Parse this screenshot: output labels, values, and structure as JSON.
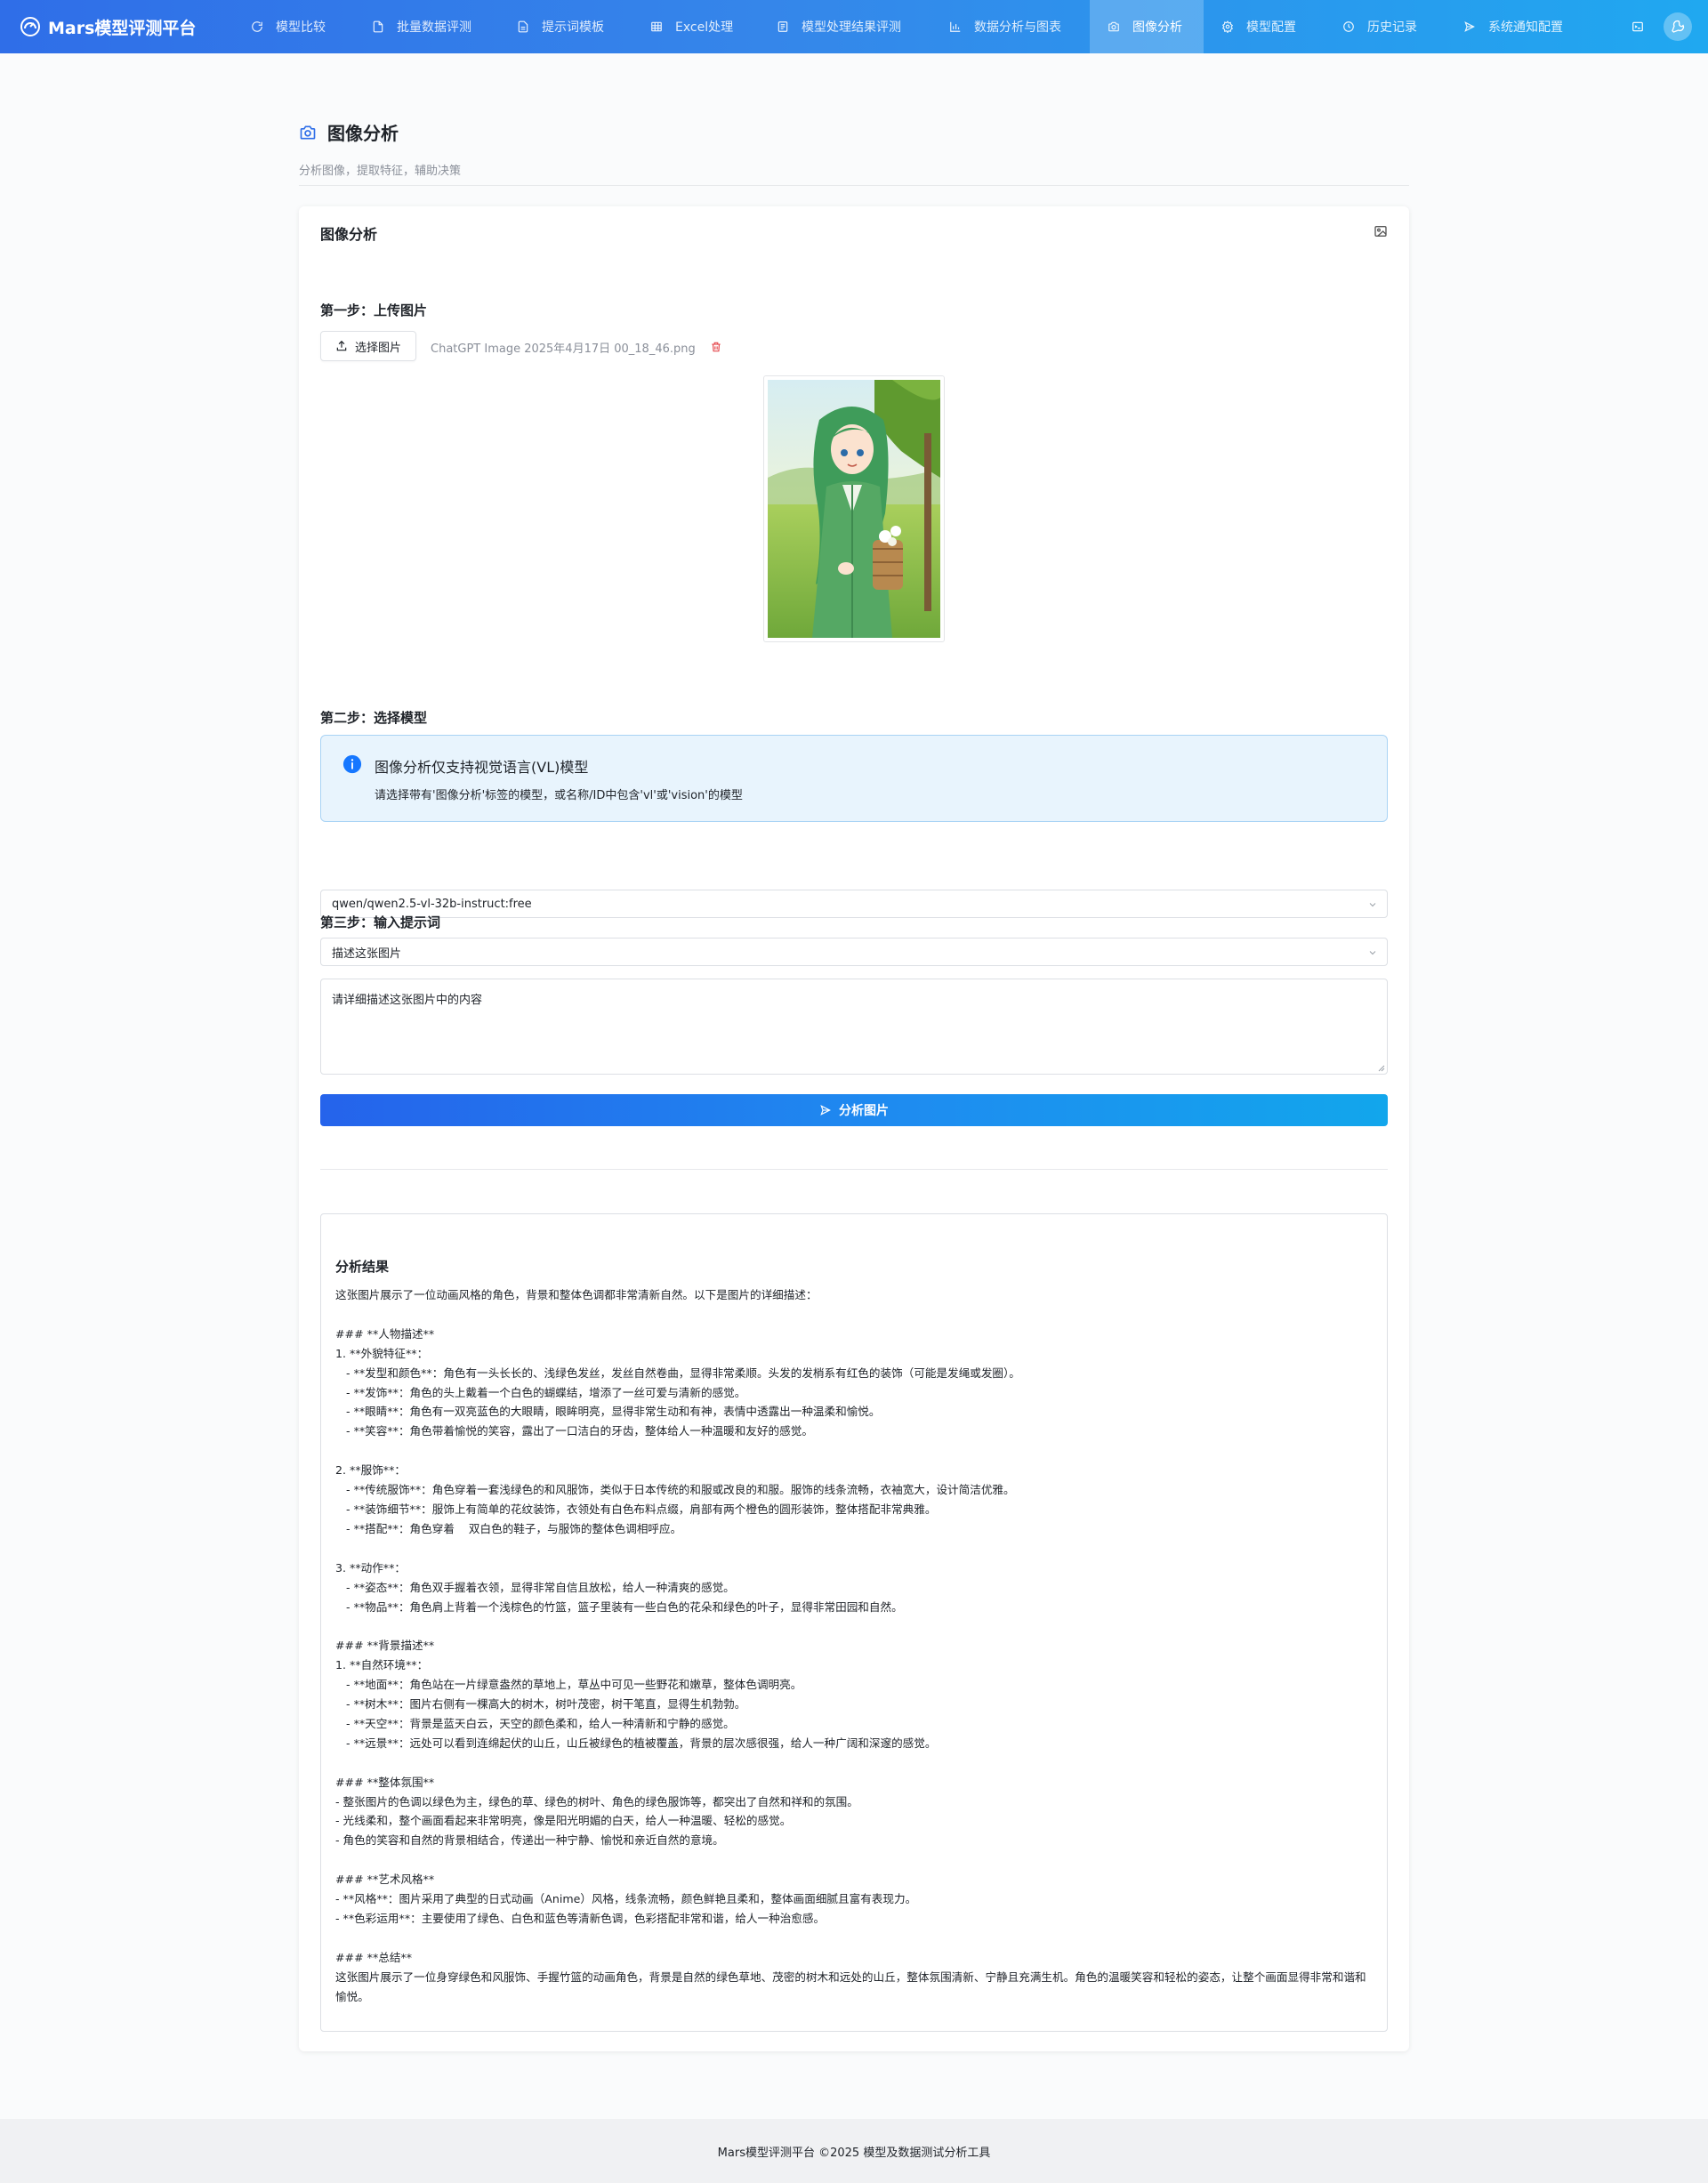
{
  "app": {
    "brand": "Mars模型评测平台"
  },
  "nav": [
    {
      "label": "模型比较",
      "icon": "refresh-icon"
    },
    {
      "label": "批量数据评测",
      "icon": "file-icon"
    },
    {
      "label": "提示词模板",
      "icon": "document-icon"
    },
    {
      "label": "Excel处理",
      "icon": "table-icon"
    },
    {
      "label": "模型处理结果评测",
      "icon": "checklist-icon"
    },
    {
      "label": "数据分析与图表",
      "icon": "bar-chart-icon"
    },
    {
      "label": "图像分析",
      "icon": "camera-icon",
      "active": true
    },
    {
      "label": "模型配置",
      "icon": "gear-icon"
    },
    {
      "label": "历史记录",
      "icon": "history-icon"
    },
    {
      "label": "系统通知配置",
      "icon": "send-icon"
    }
  ],
  "header": {
    "title": "图像分析",
    "subtitle": "分析图像，提取特征，辅助决策"
  },
  "card": {
    "title": "图像分析"
  },
  "step1": {
    "title": "第一步：上传图片",
    "button_label": "选择图片",
    "file_name": "ChatGPT Image 2025年4月17日 00_18_46.png"
  },
  "step2": {
    "title": "第二步：选择模型",
    "alert_title": "图像分析仅支持视觉语言(VL)模型",
    "alert_desc": "请选择带有'图像分析'标签的模型，或名称/ID中包含'vl'或'vision'的模型",
    "model_value": "qwen/qwen2.5-vl-32b-instruct:free"
  },
  "step3": {
    "title": "第三步：输入提示词",
    "template_value": "描述这张图片",
    "prompt_value": "请详细描述这张图片中的内容"
  },
  "analyze_button": "分析图片",
  "result": {
    "title": "分析结果",
    "text": "这张图片展示了一位动画风格的角色，背景和整体色调都非常清新自然。以下是图片的详细描述：\n\n### **人物描述**\n1. **外貌特征**：\n   - **发型和颜色**：角色有一头长长的、浅绿色发丝，发丝自然卷曲，显得非常柔顺。头发的发梢系有红色的装饰（可能是发绳或发圈）。\n   - **发饰**：角色的头上戴着一个白色的蝴蝶结，增添了一丝可爱与清新的感觉。\n   - **眼睛**：角色有一双亮蓝色的大眼睛，眼眸明亮，显得非常生动和有神，表情中透露出一种温柔和愉悦。\n   - **笑容**：角色带着愉悦的笑容，露出了一口洁白的牙齿，整体给人一种温暖和友好的感觉。\n\n2. **服饰**：\n   - **传统服饰**：角色穿着一套浅绿色的和风服饰，类似于日本传统的和服或改良的和服。服饰的线条流畅，衣袖宽大，设计简洁优雅。\n   - **装饰细节**：服饰上有简单的花纹装饰，衣领处有白色布料点缀，肩部有两个橙色的圆形装饰，整体搭配非常典雅。\n   - **搭配**：角色穿着    双白色的鞋子，与服饰的整体色调相呼应。\n\n3. **动作**：\n   - **姿态**：角色双手握着衣领，显得非常自信且放松，给人一种清爽的感觉。\n   - **物品**：角色肩上背着一个浅棕色的竹篮，篮子里装有一些白色的花朵和绿色的叶子，显得非常田园和自然。\n\n### **背景描述**\n1. **自然环境**：\n   - **地面**：角色站在一片绿意盎然的草地上，草丛中可见一些野花和嫩草，整体色调明亮。\n   - **树木**：图片右侧有一棵高大的树木，树叶茂密，树干笔直，显得生机勃勃。\n   - **天空**：背景是蓝天白云，天空的颜色柔和，给人一种清新和宁静的感觉。\n   - **远景**：远处可以看到连绵起伏的山丘，山丘被绿色的植被覆盖，背景的层次感很强，给人一种广阔和深邃的感觉。\n\n### **整体氛围**\n- 整张图片的色调以绿色为主，绿色的草、绿色的树叶、角色的绿色服饰等，都突出了自然和祥和的氛围。\n- 光线柔和，整个画面看起来非常明亮，像是阳光明媚的白天，给人一种温暖、轻松的感觉。\n- 角色的笑容和自然的背景相结合，传递出一种宁静、愉悦和亲近自然的意境。\n\n### **艺术风格**\n- **风格**：图片采用了典型的日式动画（Anime）风格，线条流畅，颜色鲜艳且柔和，整体画面细腻且富有表现力。\n- **色彩运用**：主要使用了绿色、白色和蓝色等清新色调，色彩搭配非常和谐，给人一种治愈感。\n\n### **总结**\n这张图片展示了一位身穿绿色和风服饰、手握竹篮的动画角色，背景是自然的绿色草地、茂密的树木和远处的山丘，整体氛围清新、宁静且充满生机。角色的温暖笑容和轻松的姿态，让整个画面显得非常和谐和愉悦。"
  },
  "footer": {
    "text": "Mars模型评测平台 ©2025 模型及数据测试分析工具"
  },
  "colors": {
    "brand_gradient_start": "#2f6ee8",
    "brand_gradient_end": "#20a8f0",
    "alert_bg": "#e8f4fd",
    "alert_border": "#a9d3f5",
    "info_blue": "#1677ff",
    "danger_red": "#e5484d"
  }
}
